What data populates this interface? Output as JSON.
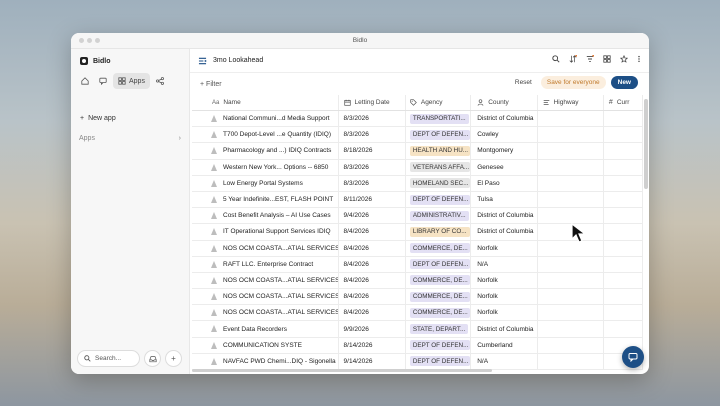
{
  "window": {
    "title": "Bidlo"
  },
  "sidebar": {
    "brand": "Bidlo",
    "nav": {
      "apps_label": "Apps"
    },
    "new_app": "New app",
    "apps_section": "Apps",
    "search_placeholder": "Search..."
  },
  "view": {
    "title": "3mo Lookahead"
  },
  "toolbar": {
    "filter_label": "Filter",
    "reset_label": "Reset",
    "save_label": "Save for everyone",
    "new_label": "New"
  },
  "columns": [
    "Name",
    "Letting Date",
    "Agency",
    "County",
    "Highway",
    "Curr"
  ],
  "colors": {
    "accent": "#1d4f86",
    "tag_transportation": "#e3e0f4",
    "tag_defense": "#e3e0f4",
    "tag_health": "#f6e3c4",
    "tag_veterans": "#e6e6e6",
    "tag_homeland": "#e6e6e6",
    "tag_admin": "#e3e0f4",
    "tag_library": "#f6e3c4",
    "tag_commerce": "#e3e0f4",
    "tag_state": "#e3e0f4"
  },
  "rows": [
    {
      "name": "National Communi...d Media Support",
      "date": "8/3/2026",
      "agency": "TRANSPORTATI...",
      "agency_color": "#e3e0f4",
      "county": "District of Columbia"
    },
    {
      "name": "T700 Depot-Level ...e Quantity (IDIQ)",
      "date": "8/3/2026",
      "agency": "DEPT OF DEFEN...",
      "agency_color": "#e3e0f4",
      "county": "Cowley"
    },
    {
      "name": "Pharmacology and ...) IDIQ Contracts",
      "date": "8/18/2026",
      "agency": "HEALTH AND HU...",
      "agency_color": "#f6e3c4",
      "county": "Montgomery"
    },
    {
      "name": "Western New York... Options -- 6850",
      "date": "8/3/2026",
      "agency": "VETERANS AFFA...",
      "agency_color": "#e6e6e6",
      "county": "Genesee"
    },
    {
      "name": "Low Energy Portal Systems",
      "date": "8/3/2026",
      "agency": "HOMELAND SEC...",
      "agency_color": "#e6e6e6",
      "county": "El Paso"
    },
    {
      "name": "5 Year Indefinite...EST, FLASH POINT",
      "date": "8/11/2026",
      "agency": "DEPT OF DEFEN...",
      "agency_color": "#e3e0f4",
      "county": "Tulsa"
    },
    {
      "name": "Cost Benefit Analysis – AI Use Cases",
      "date": "9/4/2026",
      "agency": "ADMINISTRATIV...",
      "agency_color": "#e3e0f4",
      "county": "District of Columbia"
    },
    {
      "name": "IT Operational Support Services IDIQ",
      "date": "8/4/2026",
      "agency": "LIBRARY OF CO...",
      "agency_color": "#f6e3c4",
      "county": "District of Columbia"
    },
    {
      "name": "NOS OCM COASTA...ATIAL SERVICES",
      "date": "8/4/2026",
      "agency": "COMMERCE, DE...",
      "agency_color": "#e3e0f4",
      "county": "Norfolk"
    },
    {
      "name": "RAFT LLC. Enterprise Contract",
      "date": "8/4/2026",
      "agency": "DEPT OF DEFEN...",
      "agency_color": "#e3e0f4",
      "county": "N/A"
    },
    {
      "name": "NOS OCM COASTA...ATIAL SERVICES",
      "date": "8/4/2026",
      "agency": "COMMERCE, DE...",
      "agency_color": "#e3e0f4",
      "county": "Norfolk"
    },
    {
      "name": "NOS OCM COASTA...ATIAL SERVICES",
      "date": "8/4/2026",
      "agency": "COMMERCE, DE...",
      "agency_color": "#e3e0f4",
      "county": "Norfolk"
    },
    {
      "name": "NOS OCM COASTA...ATIAL SERVICES",
      "date": "8/4/2026",
      "agency": "COMMERCE, DE...",
      "agency_color": "#e3e0f4",
      "county": "Norfolk"
    },
    {
      "name": "Event Data Recorders",
      "date": "9/9/2026",
      "agency": "STATE, DEPART...",
      "agency_color": "#e3e0f4",
      "county": "District of Columbia"
    },
    {
      "name": "COMMUNICATION SYSTE",
      "date": "8/14/2026",
      "agency": "DEPT OF DEFEN...",
      "agency_color": "#e3e0f4",
      "county": "Cumberland"
    },
    {
      "name": "NAVFAC PWD Chemi...DIQ - Sigonella",
      "date": "9/14/2026",
      "agency": "DEPT OF DEFEN...",
      "agency_color": "#e3e0f4",
      "county": "N/A"
    }
  ]
}
